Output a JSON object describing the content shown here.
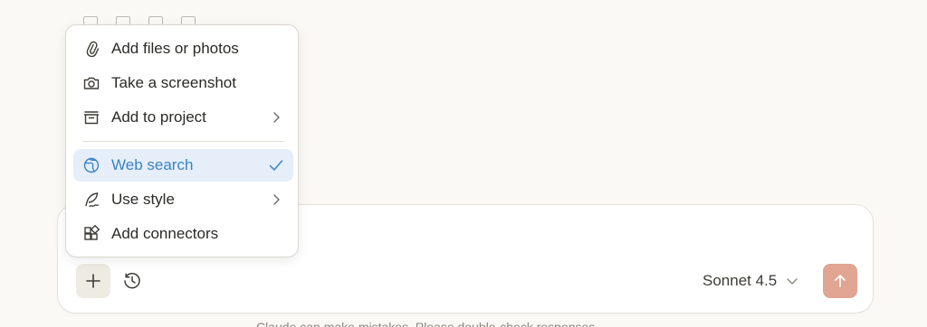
{
  "menu": {
    "items": [
      {
        "label": "Add files or photos",
        "icon": "paperclip-icon"
      },
      {
        "label": "Take a screenshot",
        "icon": "camera-icon"
      },
      {
        "label": "Add to project",
        "icon": "project-box-icon",
        "has_submenu": true
      },
      {
        "label": "Web search",
        "icon": "globe-icon",
        "checked": true
      },
      {
        "label": "Use style",
        "icon": "feather-pen-icon",
        "has_submenu": true
      },
      {
        "label": "Add connectors",
        "icon": "connectors-grid-icon"
      }
    ]
  },
  "composer": {
    "add_button_icon": "plus-icon",
    "history_button_icon": "clock-history-icon",
    "model_label": "Sonnet 4.5",
    "model_dropdown_icon": "chevron-down-icon",
    "send_button_icon": "arrow-up-icon"
  },
  "footer": {
    "disclaimer": "Claude can make mistakes. Please double-check responses."
  },
  "colors": {
    "background": "#faf9f5",
    "selected_bg": "#e5eef9",
    "selected_text": "#3b82c4",
    "send_button": "#e0a593"
  }
}
